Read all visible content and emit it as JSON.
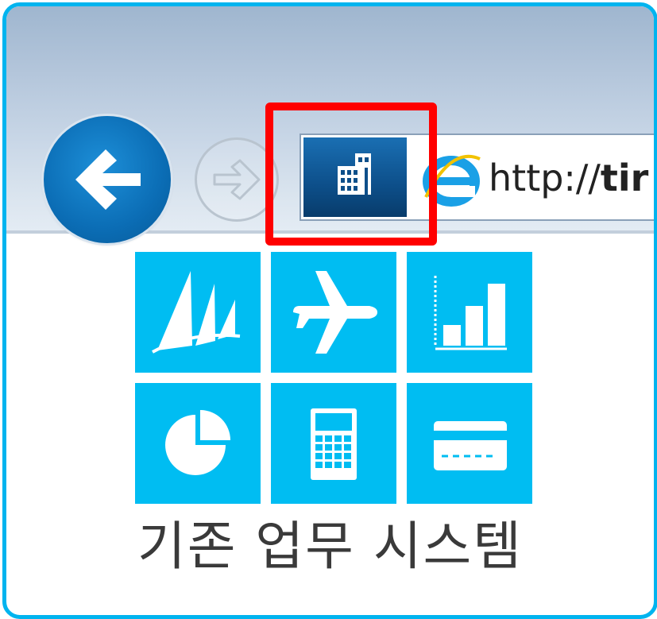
{
  "browser": {
    "back_button_icon": "back-arrow-icon",
    "forward_button_icon": "forward-arrow-icon",
    "site_icon": "building-icon",
    "address_icon": "internet-explorer-icon",
    "url_prefix": "http://",
    "url_bold": "tir"
  },
  "tiles": [
    {
      "icon": "dynamics-sails-icon"
    },
    {
      "icon": "airplane-icon"
    },
    {
      "icon": "bar-chart-icon"
    },
    {
      "icon": "pie-chart-icon"
    },
    {
      "icon": "calculator-icon"
    },
    {
      "icon": "credit-card-icon"
    }
  ],
  "caption": "기존 업무 시스템",
  "colors": {
    "frame": "#00b4ef",
    "tile": "#00bdf2",
    "highlight": "#ff0000",
    "site_icon_bg": "#0d4f8a",
    "back_button": "#0b6db5"
  }
}
